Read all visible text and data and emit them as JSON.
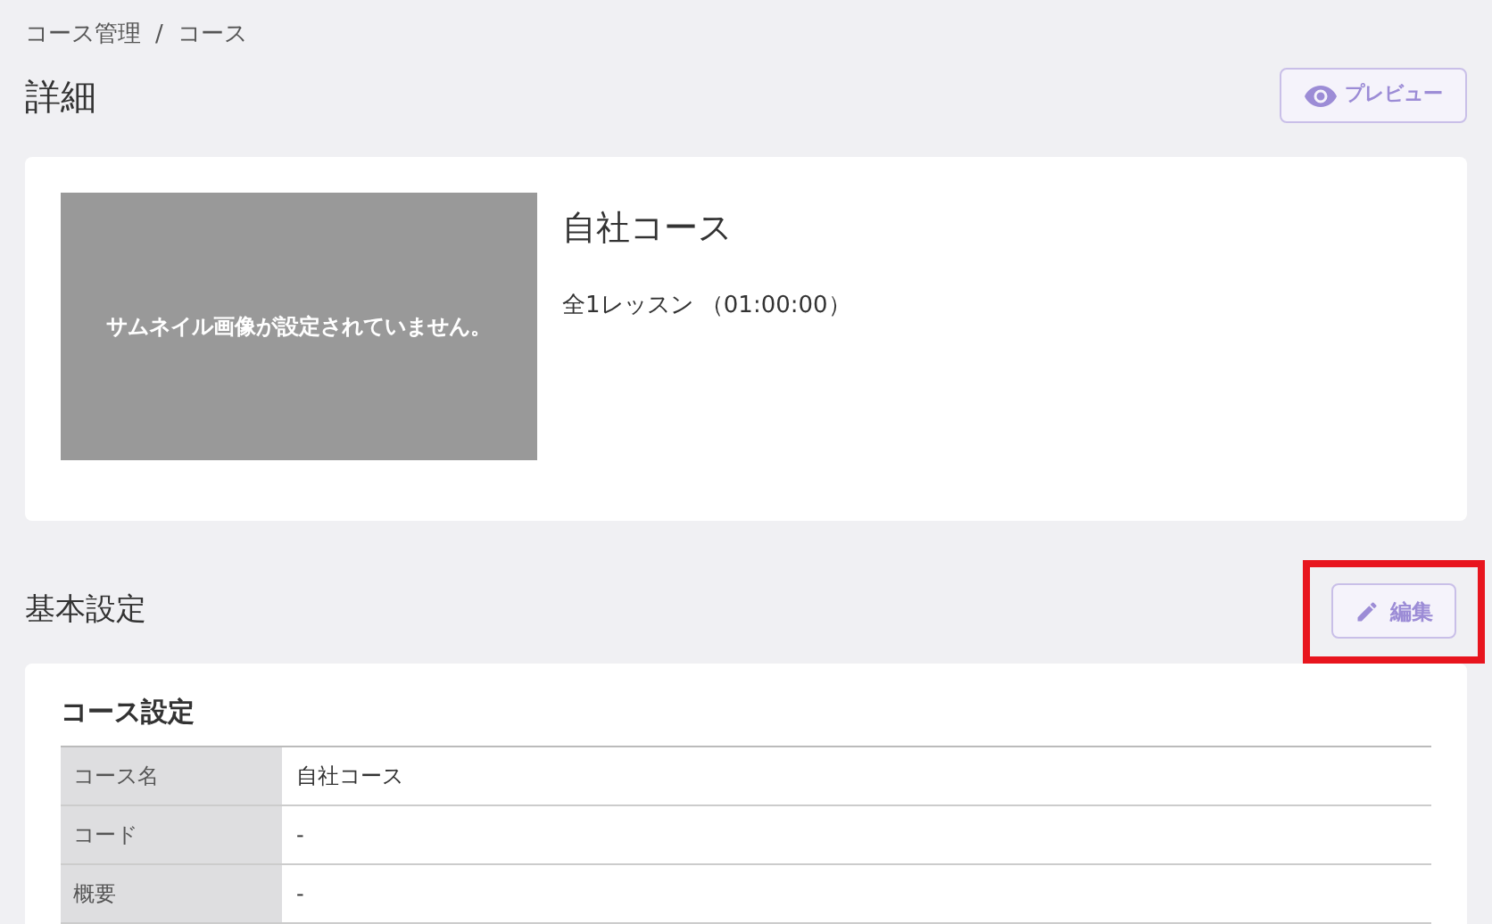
{
  "breadcrumb": [
    "コース管理",
    "コース"
  ],
  "breadcrumb_separator": "/",
  "page_title": "詳細",
  "preview_button": {
    "label": "プレビュー"
  },
  "course_card": {
    "thumbnail_text": "サムネイル画像が設定されていません。",
    "title": "自社コース",
    "lessons": "全1レッスン （01:00:00）"
  },
  "section": {
    "title": "基本設定",
    "edit_button": {
      "label": "編集",
      "highlighted": true
    }
  },
  "settings_card": {
    "title": "コース設定",
    "rows": [
      {
        "label": "コース名",
        "value": "自社コース"
      },
      {
        "label": "コード",
        "value": "-"
      },
      {
        "label": "概要",
        "value": "-"
      }
    ]
  }
}
